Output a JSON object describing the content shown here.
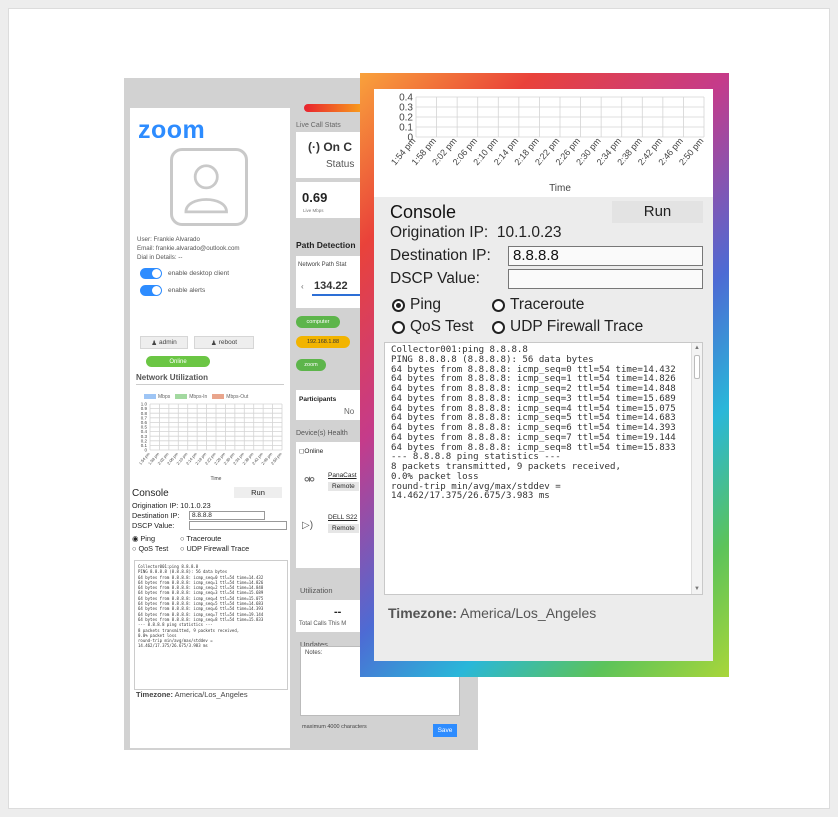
{
  "left_panel": {
    "logo": "zoom",
    "user": "User: Frankie Alvarado",
    "email": "Email: frankie.alvarado@outlook.com",
    "dial_in": "Dial in Details: --",
    "toggle_desktop": "enable desktop client",
    "toggle_alerts": "enable alerts",
    "admin_button": "admin",
    "reboot_button": "reboot",
    "status_pill": "Online",
    "network_title": "Network Utilization",
    "legend": [
      "Mbps",
      "Mbps-In",
      "Mbps-Out"
    ],
    "legend_colors": [
      "#9ec5f5",
      "#a3d9a0",
      "#e9a58c"
    ],
    "small_y_ticks": [
      "1.0",
      "0.9",
      "0.8",
      "0.7",
      "0.6",
      "0.5",
      "0.4",
      "0.3",
      "0.2",
      "0.1",
      "0"
    ],
    "small_x_label": "Time",
    "small_console": {
      "title": "Console",
      "run": "Run",
      "origination": "Origination IP:  10.1.0.23",
      "destination_label": "Destination IP:",
      "destination_value": "8.8.8.8",
      "dscp_label": "DSCP Value:",
      "ping": "Ping",
      "traceroute": "Traceroute",
      "qos": "QoS Test",
      "udp": "UDP Firewall Trace"
    },
    "timezone_label": "Timezone:",
    "timezone_value": "America/Los_Angeles"
  },
  "middle_panel": {
    "live_call_stats": "Live Call Stats",
    "on_call": "On C",
    "status": "Status",
    "live_value": "0.69",
    "live_unit": "Live Mbps",
    "path_detection": "Path Detection",
    "network_path_status": "Network Path Stat",
    "ip_partial": "134.22",
    "pill_computer": "computer",
    "pill_ip": "192.168.1.88",
    "pill_zoom": "zoom",
    "participants_tab": "Participants",
    "participants_no": "No",
    "device_health": "Device(s) Health",
    "device_online": "Online",
    "device1_name": "PanaCast",
    "device1_btn": "Remote",
    "device2_name": "DELL S22",
    "device2_btn": "Remote",
    "utilization": "Utilization",
    "total_value": "--",
    "total_calls": "Total Calls This M",
    "updates": "Updates",
    "notes_label": "Notes:",
    "max_chars": "maximum 4000 characters",
    "save": "Save"
  },
  "zoomed": {
    "chart_y_ticks": [
      "0.4",
      "0.3",
      "0.2",
      "0.1",
      "0"
    ],
    "chart_x_ticks": [
      "1:54 pm",
      "1:58 pm",
      "2:02 pm",
      "2:06 pm",
      "2:10 pm",
      "2:14 pm",
      "2:18 pm",
      "2:22 pm",
      "2:26 pm",
      "2:30 pm",
      "2:34 pm",
      "2:38 pm",
      "2:42 pm",
      "2:46 pm",
      "2:50 pm"
    ],
    "chart_x_label": "Time",
    "console_title": "Console",
    "run_label": "Run",
    "origination_label": "Origination IP:",
    "origination_value": "10.1.0.23",
    "destination_label": "Destination IP:",
    "destination_value": "8.8.8.8",
    "dscp_label": "DSCP Value:",
    "dscp_value": "",
    "radio_ping": "Ping",
    "radio_traceroute": "Traceroute",
    "radio_qos": "QoS Test",
    "radio_udp": "UDP Firewall Trace",
    "output": "Collector001:ping 8.8.8.8\nPING 8.8.8.8 (8.8.8.8): 56 data bytes\n64 bytes from 8.8.8.8: icmp_seq=0 ttl=54 time=14.432\n64 bytes from 8.8.8.8: icmp_seq=1 ttl=54 time=14.826\n64 bytes from 8.8.8.8: icmp_seq=2 ttl=54 time=14.848\n64 bytes from 8.8.8.8: icmp_seq=3 ttl=54 time=15.689\n64 bytes from 8.8.8.8: icmp_seq=4 ttl=54 time=15.075\n64 bytes from 8.8.8.8: icmp_seq=5 ttl=54 time=14.683\n64 bytes from 8.8.8.8: icmp_seq=6 ttl=54 time=14.393\n64 bytes from 8.8.8.8: icmp_seq=7 ttl=54 time=19.144\n64 bytes from 8.8.8.8: icmp_seq=8 ttl=54 time=15.833\n--- 8.8.8.8 ping statistics ---\n8 packets transmitted, 9 packets received,\n0.0% packet loss\nround-trip min/avg/max/stddev =\n14.462/17.375/26.675/3.983 ms",
    "timezone_label": "Timezone:",
    "timezone_value": "America/Los_Angeles"
  }
}
